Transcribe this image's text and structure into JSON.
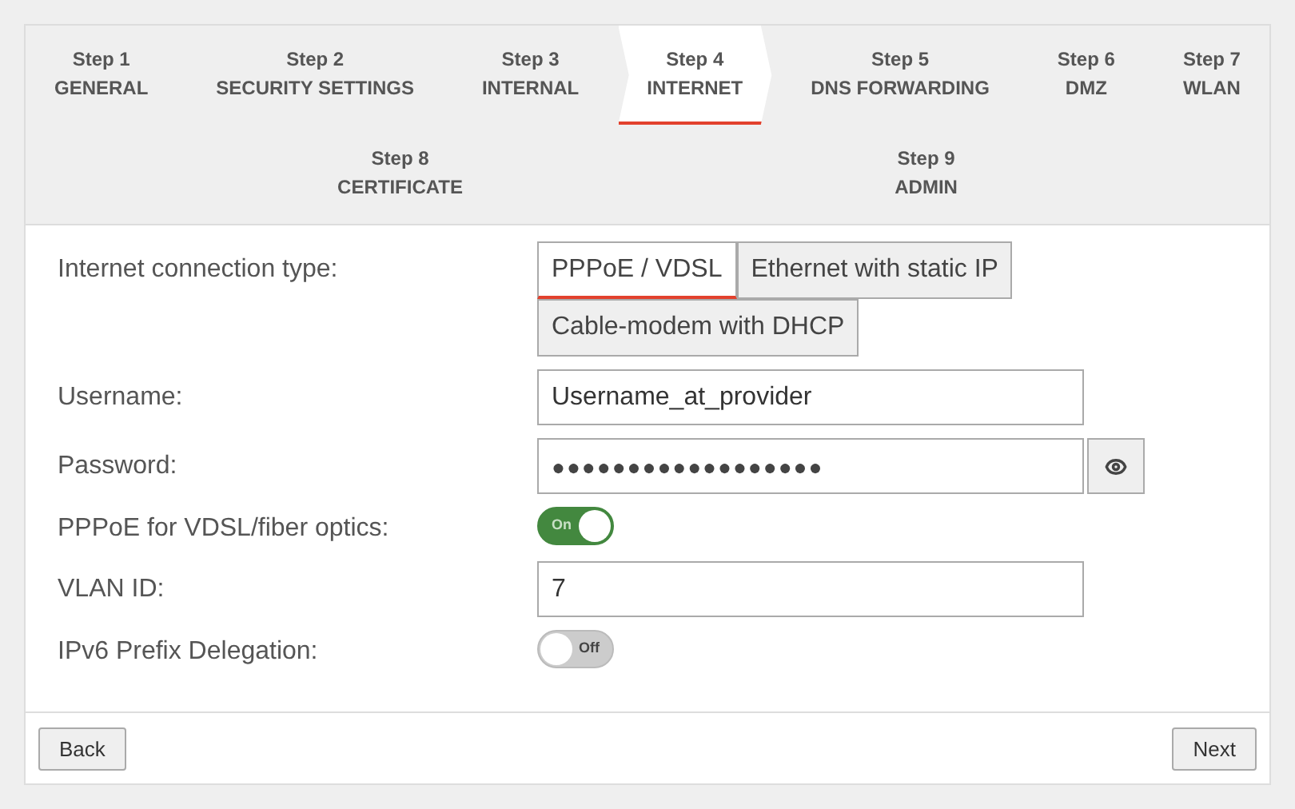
{
  "step_rows": [
    [
      {
        "step": "Step 1",
        "label": "GENERAL",
        "selected": false
      },
      {
        "step": "Step 2",
        "label": "SECURITY SETTINGS",
        "selected": false
      },
      {
        "step": "Step 3",
        "label": "INTERNAL",
        "selected": false
      },
      {
        "step": "Step 4",
        "label": "INTERNET",
        "selected": true
      },
      {
        "step": "Step 5",
        "label": "DNS FORWARDING",
        "selected": false
      },
      {
        "step": "Step 6",
        "label": "DMZ",
        "selected": false
      },
      {
        "step": "Step 7",
        "label": "WLAN",
        "selected": false
      }
    ],
    [
      {
        "step": "Step 8",
        "label": "CERTIFICATE",
        "selected": false
      },
      {
        "step": "Step 9",
        "label": "ADMIN",
        "selected": false
      }
    ]
  ],
  "fields": [
    {
      "kind": "choice",
      "label": "Internet connection type:",
      "options": [
        {
          "label": "PPPoE / VDSL",
          "selected": true
        },
        {
          "label": "Ethernet with static IP",
          "selected": false
        },
        {
          "label": "Cable-modem with DHCP",
          "selected": false
        }
      ]
    },
    {
      "kind": "text",
      "label": "Username:",
      "value": "Username_at_provider"
    },
    {
      "kind": "password",
      "label": "Password:",
      "value": "●●●●●●●●●●●●●●●●●●"
    },
    {
      "kind": "toggle",
      "label": "PPPoE for VDSL/fiber optics:",
      "on": true,
      "toggle_text": "On"
    },
    {
      "kind": "text",
      "label": "VLAN ID:",
      "value": "7"
    },
    {
      "kind": "toggle",
      "label": "IPv6 Prefix Delegation:",
      "on": false,
      "toggle_text": "Off"
    }
  ],
  "buttons": {
    "back": "Back",
    "next": "Next"
  }
}
